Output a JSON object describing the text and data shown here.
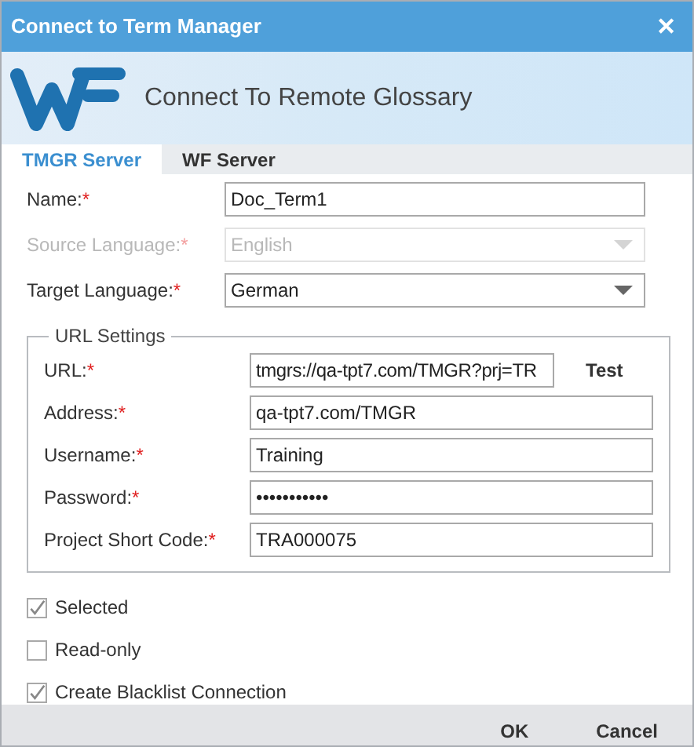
{
  "window": {
    "title": "Connect to Term Manager",
    "close": "✕"
  },
  "banner": {
    "heading": "Connect To Remote Glossary"
  },
  "tabs": [
    {
      "label": "TMGR Server",
      "selected": true
    },
    {
      "label": "WF Server",
      "selected": false
    }
  ],
  "fields": [
    {
      "kind": "text",
      "label": "Name:",
      "required_mark": "*",
      "value": "Doc_Term1",
      "disabled": false
    },
    {
      "kind": "dropdown",
      "label": "Source Language:",
      "required_mark": "*",
      "value": "English",
      "disabled": true
    },
    {
      "kind": "dropdown",
      "label": "Target Language:",
      "required_mark": "*",
      "value": "German",
      "disabled": false
    }
  ],
  "url_settings": {
    "legend": "URL Settings",
    "test_button": "Test",
    "fields": [
      {
        "kind": "url",
        "label": "URL:",
        "required_mark": "*",
        "value": "tmgrs://qa-tpt7.com/TMGR?prj=TR"
      },
      {
        "kind": "text",
        "label": "Address:",
        "required_mark": "*",
        "value": "qa-tpt7.com/TMGR"
      },
      {
        "kind": "text",
        "label": "Username:",
        "required_mark": "*",
        "value": "Training"
      },
      {
        "kind": "text",
        "label": "Password:",
        "required_mark": "*",
        "value": "•••••••••••"
      },
      {
        "kind": "text",
        "label": "Project Short Code:",
        "required_mark": "*",
        "value": "TRA000075"
      }
    ]
  },
  "checkboxes": [
    {
      "label": "Selected",
      "checked": true
    },
    {
      "label": "Read-only",
      "checked": false
    },
    {
      "label": "Create Blacklist Connection",
      "checked": true
    }
  ],
  "buttons": [
    "OK",
    "Cancel"
  ]
}
